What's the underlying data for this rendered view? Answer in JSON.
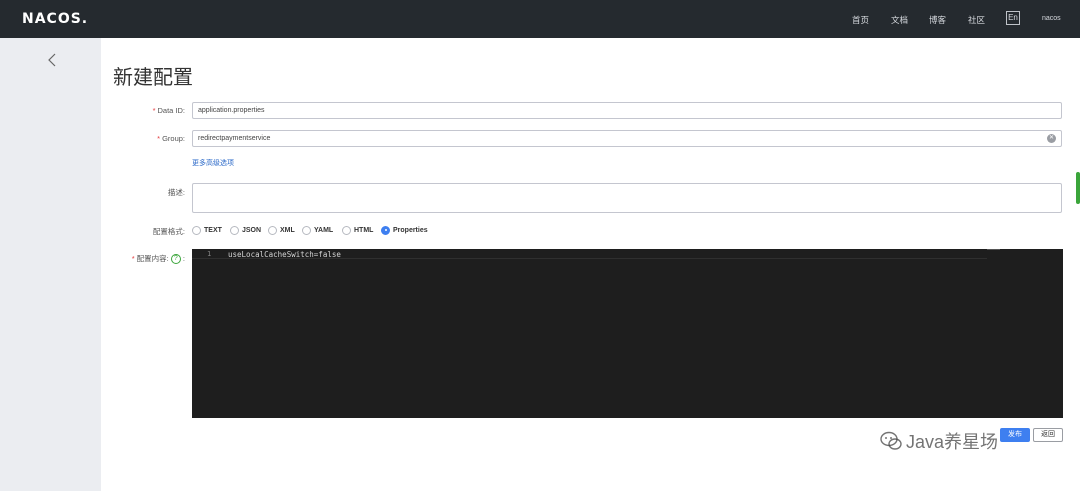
{
  "nav": {
    "logo": "NACOS.",
    "items": [
      "首页",
      "文档",
      "博客",
      "社区"
    ],
    "lang": "En",
    "user": "nacos"
  },
  "page": {
    "title": "新建配置"
  },
  "form": {
    "data_id": {
      "label": "Data ID:",
      "value": "application.properties"
    },
    "group": {
      "label": "Group:",
      "value": "redirectpaymentservice"
    },
    "advanced_link": "更多高级选项",
    "description": {
      "label": "描述:",
      "value": ""
    },
    "format": {
      "label": "配置格式:",
      "options": [
        "TEXT",
        "JSON",
        "XML",
        "YAML",
        "HTML",
        "Properties"
      ],
      "selected": "Properties"
    },
    "content": {
      "label": "配置内容:",
      "help": "?",
      "colon": ":",
      "lines": [
        {
          "no": "1",
          "text": "useLocalCacheSwitch=false"
        }
      ]
    }
  },
  "buttons": {
    "publish": "发布",
    "back": "返回"
  },
  "watermark": "Java养星场",
  "colors": {
    "topbar": "#252a2f",
    "primary": "#3e7ff0",
    "required": "#e4393c",
    "editor_bg": "#1e1e1e"
  }
}
